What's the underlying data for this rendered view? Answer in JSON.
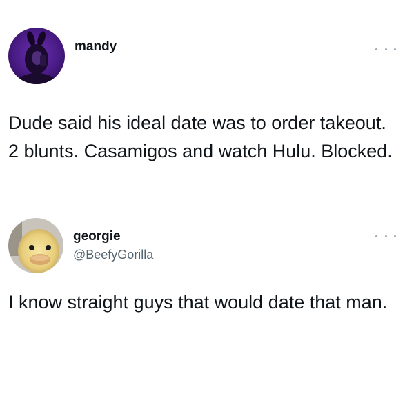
{
  "tweets": [
    {
      "author_name": "mandy",
      "handle": "",
      "avatar_icon": "user-avatar-purple-bunny-ears",
      "more_icon": "more-options-icon",
      "text": "Dude said his ideal date was to order takeout. 2 blunts. Casamigos and watch Hulu. Blocked."
    },
    {
      "author_name": "georgie",
      "handle": "@BeefyGorilla",
      "avatar_icon": "user-avatar-duckling",
      "more_icon": "more-options-icon",
      "text": "I know straight guys that would date that man."
    }
  ],
  "colors": {
    "text_primary": "#0f1419",
    "text_secondary": "#536471",
    "background": "#ffffff"
  }
}
